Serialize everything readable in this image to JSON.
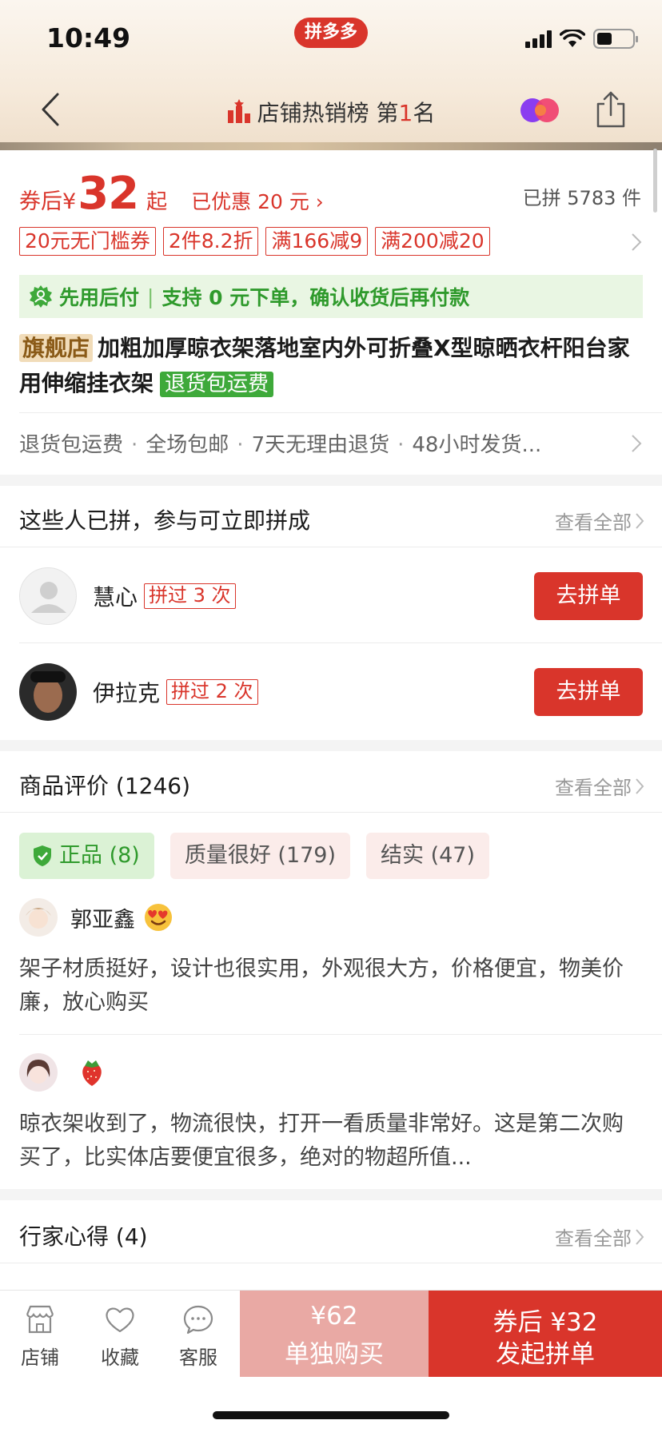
{
  "status_bar": {
    "time": "10:49",
    "app_badge": "拼多多"
  },
  "nav": {
    "title_prefix": "店铺热销榜 第",
    "rank": "1",
    "title_suffix": "名"
  },
  "price": {
    "prefix": "券后",
    "currency": "¥",
    "amount": "32",
    "suffix": "起",
    "discount_link": "已优惠 20 元 ›",
    "sold": "已拼 5783 件"
  },
  "coupons": [
    "20元无门槛券",
    "2件8.2折",
    "满166减9",
    "满200减20"
  ],
  "pay_after": {
    "label": "先用后付",
    "desc": "支持 0 元下单，确认收货后再付款"
  },
  "product": {
    "flag_tag": "旗舰店",
    "title": "加粗加厚晾衣架落地室内外可折叠X型晾晒衣杆阳台家用伸缩挂衣架",
    "return_tag": "退货包运费"
  },
  "guarantees": [
    "退货包运费",
    "全场包邮",
    "7天无理由退货",
    "48小时发货..."
  ],
  "group_buy": {
    "title": "这些人已拼，参与可立即拼成",
    "see_all": "查看全部",
    "members": [
      {
        "name": "慧心",
        "times": "拼过 3 次",
        "button": "去拼单"
      },
      {
        "name": "伊拉克",
        "times": "拼过 2 次",
        "button": "去拼单"
      }
    ]
  },
  "reviews": {
    "title": "商品评价 (1246)",
    "see_all": "查看全部",
    "tags": [
      "正品 (8)",
      "质量很好 (179)",
      "结实 (47)"
    ],
    "items": [
      {
        "name": "郭亚鑫",
        "text": "架子材质挺好，设计也很实用，外观很大方，价格便宜，物美价廉，放心购买"
      },
      {
        "name": "",
        "text": "晾衣架收到了，物流很快，打开一看质量非常好。这是第二次购买了，比实体店要便宜很多，绝对的物超所值..."
      }
    ]
  },
  "experts": {
    "title": "行家心得 (4)",
    "see_all": "查看全部"
  },
  "bottom_bar": {
    "shop": "店铺",
    "favorite": "收藏",
    "service": "客服",
    "single_price": "¥62",
    "single_label": "单独购买",
    "group_price": "券后 ¥32",
    "group_label": "发起拼单"
  },
  "colors": {
    "accent": "#d9352b",
    "green": "#2f9a2c",
    "single_btn": "#e9a9a4"
  }
}
